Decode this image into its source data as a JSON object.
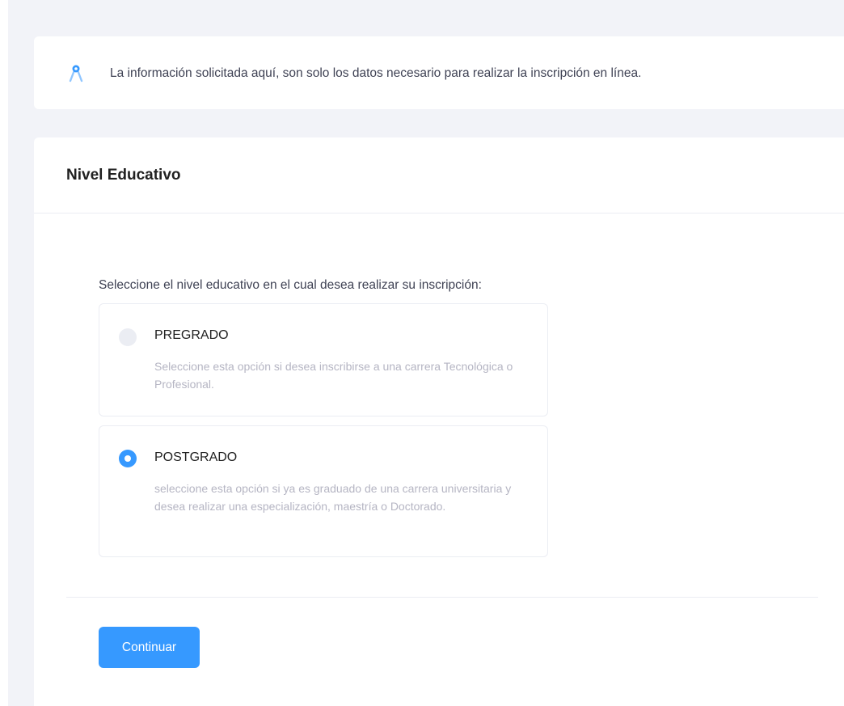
{
  "notice": {
    "icon": "compass-icon",
    "text": "La información solicitada aquí, son solo los datos necesario para realizar la inscripción en línea.",
    "accent_color": "#3699ff"
  },
  "form": {
    "title": "Nivel Educativo",
    "prompt": "Seleccione el nivel educativo en el cual desea realizar su inscripción:",
    "selected": "POSTGRADO",
    "options": [
      {
        "label": "PREGRADO",
        "description": "Seleccione esta opción si desea inscribirse a una carrera Tecnológica o Profesional.",
        "checked": false
      },
      {
        "label": "POSTGRADO",
        "description": "seleccione esta opción si ya es graduado de una carrera universitaria y desea realizar una especialización, maestría o Doctorado.",
        "checked": true
      }
    ],
    "submit_label": "Continuar",
    "primary_color": "#3699ff"
  }
}
